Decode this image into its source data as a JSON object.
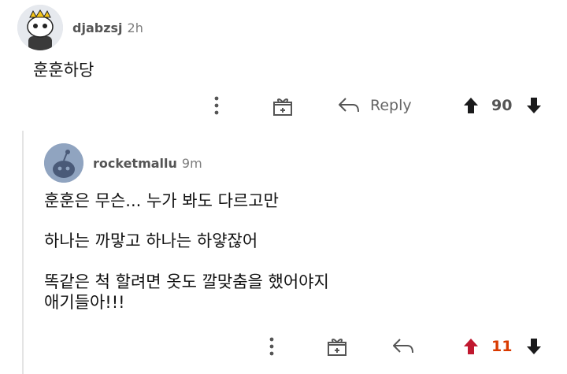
{
  "comment1": {
    "username": "djabzsj",
    "time": "2h",
    "body": "훈훈하당",
    "reply_label": "Reply",
    "score": "90",
    "score_color": "#555555",
    "upvote_color": "#1a1a1b"
  },
  "comment2": {
    "username": "rocketmallu",
    "time": "9m",
    "lines": [
      "훈훈은 무슨... 누가 봐도 다르고만",
      "하나는 까맣고 하나는 하얗잖어",
      "똑같은 척 할려면 옷도 깔맞춤을 했어야지",
      "애기들아!!!"
    ],
    "score": "11",
    "score_color": "#d93a00",
    "upvote_color": "#c0182f"
  },
  "icons": [
    "more-options-icon",
    "award-icon",
    "reply-icon",
    "upvote-icon",
    "downvote-icon"
  ]
}
